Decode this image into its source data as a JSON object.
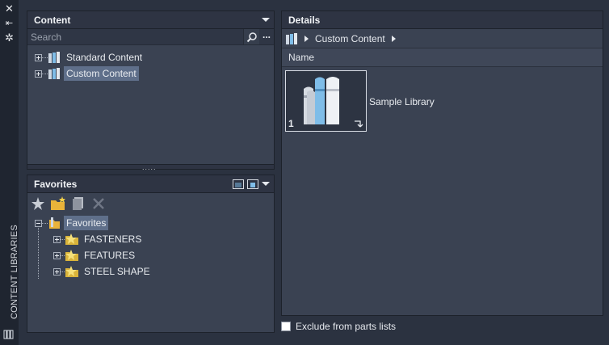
{
  "palette": {
    "title": "CONTENT LIBRARIES",
    "close_glyph": "✕",
    "autohide_glyph": "⇤",
    "settings_glyph": "✲",
    "library_icon": "library-icon"
  },
  "content_panel": {
    "title": "Content",
    "search_placeholder": "Search",
    "search_icon": "magnifier-icon",
    "more_label": "...",
    "tree": [
      {
        "label": "Standard Content",
        "icon": "library-books-icon",
        "selected": false
      },
      {
        "label": "Custom Content",
        "icon": "library-books-icon",
        "selected": true
      }
    ],
    "splitter_grip": "....."
  },
  "favorites_panel": {
    "title": "Favorites",
    "toolbar_icons": [
      "add-favorite-icon",
      "new-folder-icon",
      "copy-icon",
      "delete-icon"
    ],
    "root": {
      "label": "Favorites",
      "icon": "favorites-folder-icon"
    },
    "children": [
      {
        "label": "FASTENERS",
        "icon": "favorite-star-icon"
      },
      {
        "label": "FEATURES",
        "icon": "favorite-star-icon"
      },
      {
        "label": "STEEL SHAPE",
        "icon": "favorite-star-icon"
      }
    ]
  },
  "details_panel": {
    "title": "Details",
    "breadcrumb": "Custom Content",
    "column_header": "Name",
    "items": [
      {
        "label": "Sample Library",
        "icon": "library-books-icon",
        "badge": "1"
      }
    ]
  },
  "exclude_checkbox": {
    "label": "Exclude from parts lists",
    "checked": false
  },
  "colors": {
    "background": "#2b3240",
    "panel": "#3a4252",
    "header": "#2e3443",
    "selection": "#5f6f8a",
    "book_blue": "#7fbde8"
  }
}
